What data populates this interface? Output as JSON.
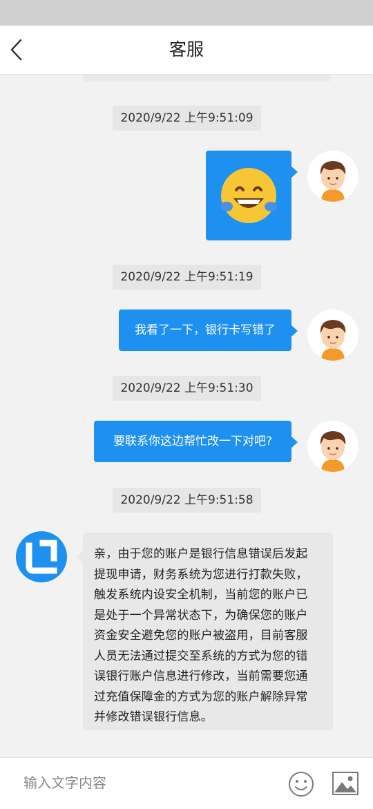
{
  "header": {
    "title": "客服",
    "back_icon": "chevron-left-icon"
  },
  "messages": [
    {
      "timestamp": "2020/9/22 上午9:51:09",
      "sender": "user",
      "type": "emoji",
      "emoji": "face-with-tears-of-joy"
    },
    {
      "timestamp": "2020/9/22 上午9:51:19",
      "sender": "user",
      "type": "text",
      "text": "我看了一下，银行卡写错了"
    },
    {
      "timestamp": "2020/9/22 上午9:51:30",
      "sender": "user",
      "type": "text",
      "text": "要联系你这边帮忙改一下对吧?"
    },
    {
      "timestamp": "2020/9/22 上午9:51:58",
      "sender": "agent",
      "type": "text",
      "lines": [
        "亲，由于您的账户是银行信息错误后发起",
        "提现申请，财务系统为您进行打款失败，",
        "触发系统内设安全机制，当前您的账户已",
        "是处于一个异常状态下，为确保您的账户",
        "资金安全避免您的账户被盗用，目前客服",
        "人员无法通过提交至系统的方式为您的错",
        "误银行账户信息进行修改，当前需要您通",
        "过充值保障金的方式为您的账户解除异常",
        "并修改错误银行信息。"
      ]
    }
  ],
  "input": {
    "placeholder": "输入文字内容",
    "value": "",
    "emoji_icon": "smiley-icon",
    "image_icon": "image-icon"
  },
  "colors": {
    "bubble_blue": "#1e90f0",
    "agent_bubble": "#e8e8e8",
    "background": "#f2f2f2"
  }
}
